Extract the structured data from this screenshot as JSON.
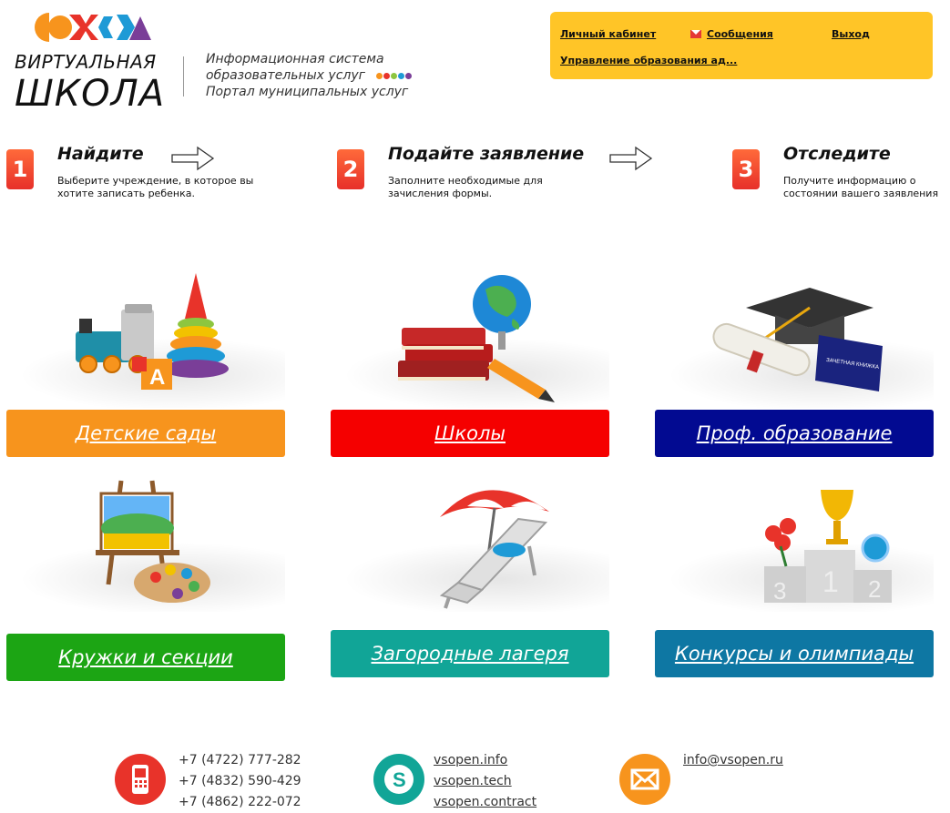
{
  "logo": {
    "line1": "ВИРТУАЛЬНАЯ",
    "line2": "ШКОЛА",
    "shape_colors": [
      "#f7941d",
      "#e8332a",
      "#1e9ad6",
      "#7a3e98"
    ]
  },
  "system": {
    "line1": "Информационная система",
    "line2": "образовательных услуг",
    "line3": "Портал муниципальных услуг",
    "dot_colors": [
      "#f7941d",
      "#e8332a",
      "#8dc63f",
      "#1e9ad6",
      "#7a3e98"
    ]
  },
  "user_menu": {
    "account": "Личный кабинет",
    "messages": "Сообщения",
    "logout": "Выход",
    "organization": "Управление образования ад...",
    "background": "#ffc527"
  },
  "steps": [
    {
      "number": "1",
      "title": "Найдите",
      "desc": "Выберите учреждение, в которое вы хотите записать ребенка."
    },
    {
      "number": "2",
      "title": "Подайте заявление",
      "desc": "Заполните необходимые для зачисления формы."
    },
    {
      "number": "3",
      "title": "Отследите",
      "desc": "Получите информацию о состоянии вашего заявления"
    }
  ],
  "categories": [
    {
      "label": "Детские сады",
      "color": "#f7941d",
      "icon": "toys-icon"
    },
    {
      "label": "Школы",
      "color": "#f50000",
      "icon": "books-globe-icon"
    },
    {
      "label": "Проф. образование",
      "color": "#020a91",
      "icon": "graduation-cap-icon"
    },
    {
      "label": "Кружки и секции",
      "color": "#1ca514",
      "icon": "easel-palette-icon"
    },
    {
      "label": "Загородные лагеря",
      "color": "#11a597",
      "icon": "beach-chair-icon"
    },
    {
      "label": "Конкурсы и олимпиады",
      "color": "#0e77a3",
      "icon": "podium-cup-icon"
    }
  ],
  "book_label": "ЗАЧЕТНАЯ КНИЖКА",
  "footer": {
    "phones": [
      "+7 (4722) 777-282",
      "+7 (4832) 590-429",
      "+7 (4862) 222-072"
    ],
    "skype": [
      "vsopen.info",
      "vsopen.tech",
      "vsopen.contract"
    ],
    "email": "info@vsopen.ru",
    "phone_color": "#e8332a",
    "skype_color": "#11a597",
    "email_color": "#f7941d"
  }
}
